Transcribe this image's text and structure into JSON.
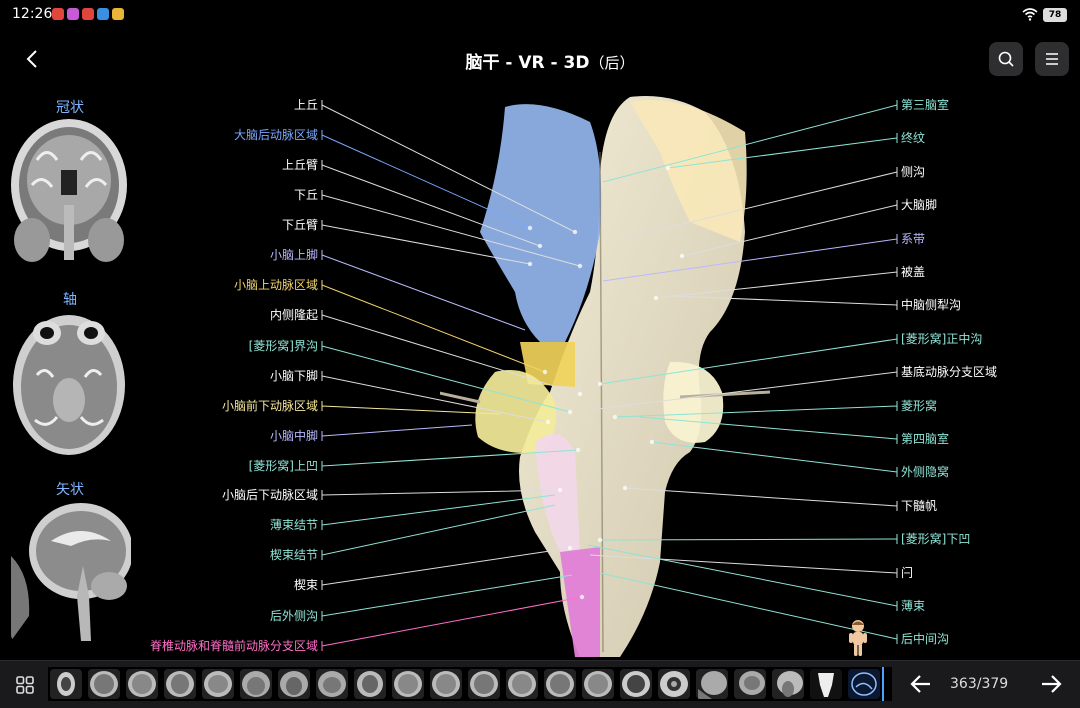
{
  "status": {
    "time": "12:26",
    "battery": "78"
  },
  "header": {
    "title": "脑干 - VR - 3D",
    "subtitle": "（后）"
  },
  "views": [
    {
      "label": "冠状"
    },
    {
      "label": "轴"
    },
    {
      "label": "矢状"
    }
  ],
  "left_labels": [
    {
      "text": "上丘",
      "color": "#ffffff"
    },
    {
      "text": "大脑后动脉区域",
      "color": "#7aa7ff"
    },
    {
      "text": "上丘臂",
      "color": "#ffffff"
    },
    {
      "text": "下丘",
      "color": "#ffffff"
    },
    {
      "text": "下丘臂",
      "color": "#ffffff"
    },
    {
      "text": "小脑上脚",
      "color": "#b9b9ff"
    },
    {
      "text": "小脑上动脉区域",
      "color": "#f2d36b"
    },
    {
      "text": "内侧隆起",
      "color": "#ffffff"
    },
    {
      "text": "[菱形窝]界沟",
      "color": "#8fe3d6"
    },
    {
      "text": "小脑下脚",
      "color": "#ffffff"
    },
    {
      "text": "小脑前下动脉区域",
      "color": "#f5e79a"
    },
    {
      "text": "小脑中脚",
      "color": "#b9b9ff"
    },
    {
      "text": "[菱形窝]上凹",
      "color": "#8fe3d6"
    },
    {
      "text": "小脑后下动脉区域",
      "color": "#ffffff"
    },
    {
      "text": "薄束结节",
      "color": "#8fe3d6"
    },
    {
      "text": "楔束结节",
      "color": "#8fe3d6"
    },
    {
      "text": "楔束",
      "color": "#ffffff"
    },
    {
      "text": "后外侧沟",
      "color": "#8fe3d6"
    },
    {
      "text": "脊椎动脉和脊髓前动脉分支区域",
      "color": "#ff6fc8"
    }
  ],
  "right_labels": [
    {
      "text": "第三脑室",
      "color": "#8fe3d6"
    },
    {
      "text": "终纹",
      "color": "#8fe3d6"
    },
    {
      "text": "侧沟",
      "color": "#ffffff"
    },
    {
      "text": "大脑脚",
      "color": "#ffffff"
    },
    {
      "text": "系带",
      "color": "#b9b9ff"
    },
    {
      "text": "被盖",
      "color": "#ffffff"
    },
    {
      "text": "中脑侧犁沟",
      "color": "#ffffff"
    },
    {
      "text": "[菱形窝]正中沟",
      "color": "#8fe3d6"
    },
    {
      "text": "基底动脉分支区域",
      "color": "#ffffff"
    },
    {
      "text": "菱形窝",
      "color": "#8fe3d6"
    },
    {
      "text": "第四脑室",
      "color": "#8fe3d6"
    },
    {
      "text": "外侧隐窝",
      "color": "#8fe3d6"
    },
    {
      "text": "下髓帆",
      "color": "#ffffff"
    },
    {
      "text": "[菱形窝]下凹",
      "color": "#8fe3d6"
    },
    {
      "text": "闩",
      "color": "#ffffff"
    },
    {
      "text": "薄束",
      "color": "#8fe3d6"
    },
    {
      "text": "后中间沟",
      "color": "#8fe3d6"
    }
  ],
  "pager": {
    "indicator": "363/379"
  },
  "icons": {
    "back": "chevron-left-icon",
    "search": "search-icon",
    "menu": "menu-icon",
    "grid": "grid-icon",
    "prev": "arrow-left-icon",
    "next": "arrow-right-icon"
  }
}
